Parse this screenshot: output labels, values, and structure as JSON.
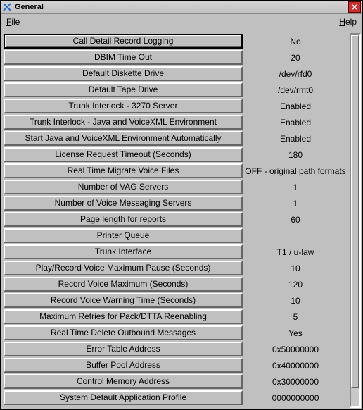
{
  "window": {
    "title": "General"
  },
  "menu": {
    "file": "File",
    "help": "Help"
  },
  "rows": [
    {
      "label": "Call Detail Record Logging",
      "value": "No",
      "selected": true
    },
    {
      "label": "DBIM Time Out",
      "value": "20"
    },
    {
      "label": "Default Diskette Drive",
      "value": "/dev/rfd0"
    },
    {
      "label": "Default Tape Drive",
      "value": "/dev/rmt0"
    },
    {
      "label": "Trunk Interlock - 3270 Server",
      "value": "Enabled"
    },
    {
      "label": "Trunk Interlock - Java and VoiceXML Environment",
      "value": "Enabled"
    },
    {
      "label": "Start Java and VoiceXML Environment Automatically",
      "value": "Enabled"
    },
    {
      "label": "License Request Timeout (Seconds)",
      "value": "180"
    },
    {
      "label": "Real Time Migrate Voice Files",
      "value": "OFF - original path formats"
    },
    {
      "label": "Number of VAG Servers",
      "value": "1"
    },
    {
      "label": "Number of Voice Messaging Servers",
      "value": "1"
    },
    {
      "label": "Page length for reports",
      "value": "60"
    },
    {
      "label": "Printer Queue",
      "value": ""
    },
    {
      "label": "Trunk Interface",
      "value": "T1 / u-law"
    },
    {
      "label": "Play/Record Voice Maximum Pause (Seconds)",
      "value": "10"
    },
    {
      "label": "Record Voice Maximum (Seconds)",
      "value": "120"
    },
    {
      "label": "Record Voice Warning Time (Seconds)",
      "value": "10"
    },
    {
      "label": "Maximum Retries for Pack/DTTA Reenabling",
      "value": "5"
    },
    {
      "label": "Real Time Delete Outbound Messages",
      "value": "Yes"
    },
    {
      "label": "Error Table Address",
      "value": "0x50000000"
    },
    {
      "label": "Buffer Pool Address",
      "value": "0x40000000"
    },
    {
      "label": "Control Memory Address",
      "value": "0x30000000"
    },
    {
      "label": "System Default Application Profile",
      "value": "0000000000"
    }
  ]
}
